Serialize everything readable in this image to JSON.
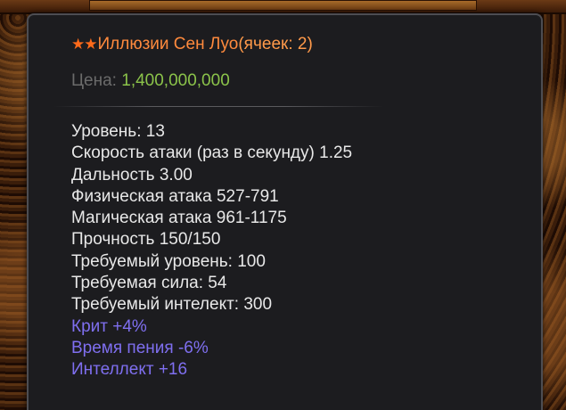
{
  "item": {
    "stars": "★★",
    "name": "Иллюзии Сен Луо",
    "slots": "(ячеек: 2)",
    "price_label": "Цена:",
    "price_value": "1,400,000,000"
  },
  "stats": [
    "Уровень: 13",
    "Скорость атаки (раз в секунду) 1.25",
    "Дальность 3.00",
    "Физическая атака 527-791",
    "Магическая атака 961-1175",
    "Прочность 150/150",
    "Требуемый уровень: 100",
    "Требуемая сила: 54",
    "Требуемый интелект: 300"
  ],
  "bonuses": [
    "Крит +4%",
    "Время пения -6%",
    "Интеллект +16"
  ],
  "colors": {
    "title": "#ff8a3d",
    "price_value": "#8bc34a",
    "bonus": "#7f6ff0",
    "stat": "#e8e8e8"
  }
}
